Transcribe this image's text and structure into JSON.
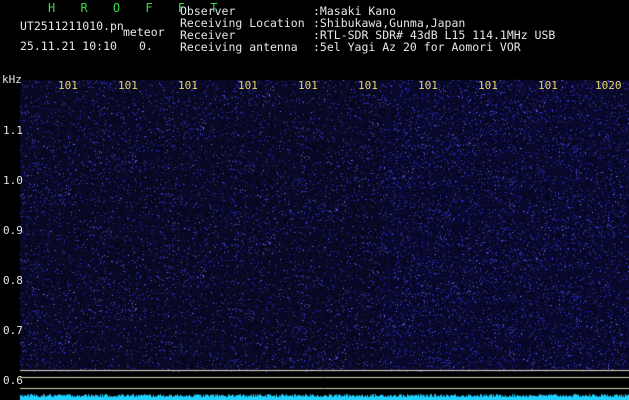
{
  "header": {
    "title": "H R O F F T",
    "file_name": "UT2511211010.pn",
    "event_type": "meteor",
    "date_time": "25.11.21 10:10",
    "count": "0.",
    "observer_label": "Observer",
    "observer_value": ":Masaki Kano",
    "location_label": "Receiving Location",
    "location_value": ":Shibukawa,Gunma,Japan",
    "receiver_label": "Receiver",
    "receiver_value": ":RTL-SDR SDR# 43dB L15 114.1MHz USB",
    "antenna_label": "Receiving antenna",
    "antenna_value": ":5el Yagi Az 20 for Aomori VOR"
  },
  "y_axis": {
    "unit": "kHz",
    "ticks": [
      "1.1",
      "1.0",
      "0.9",
      "0.8",
      "0.7",
      "0.6"
    ]
  },
  "x_axis": {
    "ticks": [
      "101",
      "101",
      "101",
      "101",
      "101",
      "101",
      "101",
      "101",
      "101",
      "1020"
    ]
  },
  "colors": {
    "background": "#000000",
    "spectrogram_base": "#0a0a3a",
    "noise_speckle": "#3a3aff",
    "baseline_lines": "#d8d8b0",
    "bottom_trace": "#20d0ff",
    "time_labels": "#e8d860",
    "title": "#3fd94a"
  }
}
